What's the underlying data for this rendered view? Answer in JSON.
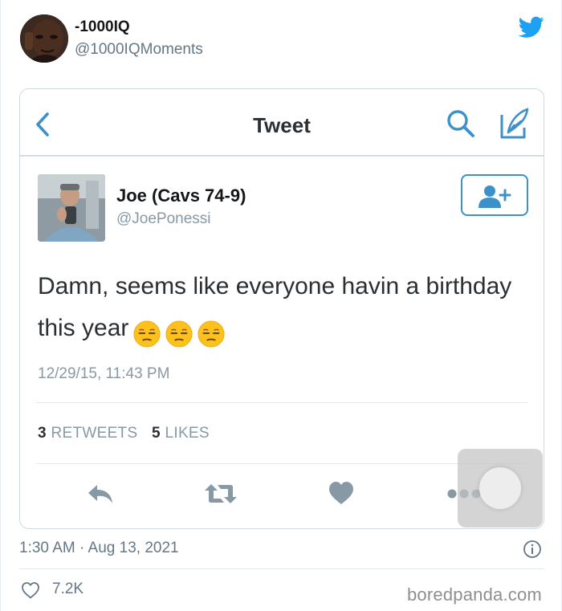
{
  "author": {
    "name": "-1000IQ",
    "handle": "@1000IQMoments"
  },
  "screenshot": {
    "nav_title": "Tweet",
    "quoted_user": {
      "name": "Joe (Cavs 74-9)",
      "handle": "@JoePonessi"
    },
    "tweet_text": "Damn, seems like everyone havin a birthday this year",
    "emoji": "unamused-face",
    "timestamp": "12/29/15, 11:43 PM",
    "stats": {
      "retweets_count": "3",
      "retweets_label": "RETWEETS",
      "likes_count": "5",
      "likes_label": "LIKES"
    }
  },
  "post_timestamp": "1:30 AM · Aug 13, 2021",
  "like_count": "7.2K",
  "watermark": "boredpanda.com",
  "colors": {
    "twitter_blue": "#1da1f2",
    "ios_blue": "#3d91c9",
    "action_gray": "#8899a6"
  }
}
